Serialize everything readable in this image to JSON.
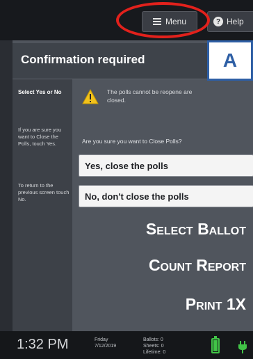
{
  "topbar": {
    "menu_label": "Menu",
    "help_label": "Help"
  },
  "dialog": {
    "title": "Confirmation required",
    "sidebar": {
      "heading": "Select Yes or No",
      "instruction_yes": "If you are sure you want to Close the Polls, touch Yes.",
      "instruction_no": "To return to the previous screen touch No."
    },
    "warning_text": "The polls cannot be reopene are closed.",
    "question": "Are you sure you want to Close Polls?",
    "yes_label": "Yes, close the polls",
    "no_label": "No, don't close the polls"
  },
  "annotation": {
    "badge": "A",
    "line1": "Select Ballot",
    "line2": "Count Report",
    "line3": "Print 1X"
  },
  "status": {
    "time": "1:32 PM",
    "day": "Friday",
    "date": "7/12/2019",
    "ballots_label": "Ballots:",
    "ballots_value": "0",
    "sheets_label": "Sheets:",
    "sheets_value": "0",
    "lifetime_label": "Lifetime:",
    "lifetime_value": "0"
  },
  "colors": {
    "highlight_ellipse": "#e2211c",
    "badge_border": "#2e5fa5",
    "battery": "#41c447"
  },
  "icons": [
    "menu-icon",
    "help-icon",
    "warning-icon",
    "battery-icon",
    "power-plug-icon"
  ]
}
